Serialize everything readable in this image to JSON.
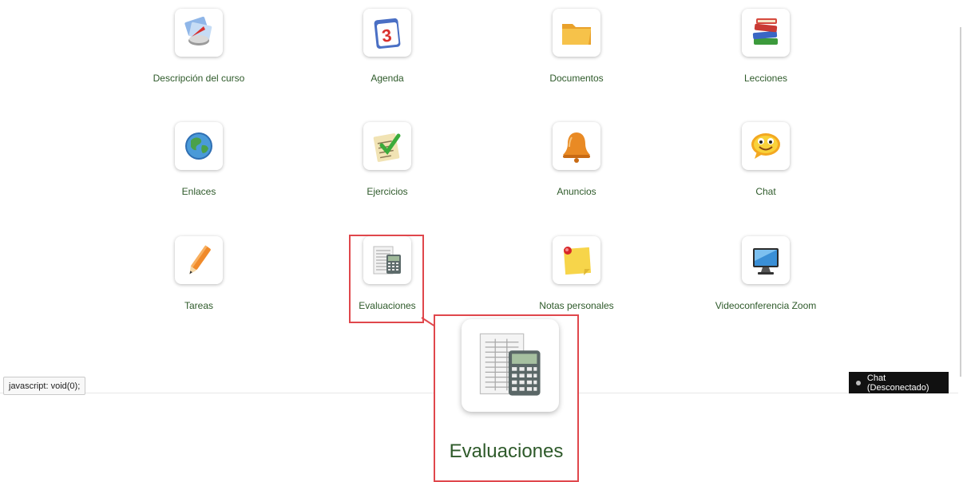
{
  "tools": [
    {
      "label": "Descripción del curso",
      "icon": "course-description-icon"
    },
    {
      "label": "Agenda",
      "icon": "calendar-icon"
    },
    {
      "label": "Documentos",
      "icon": "folder-icon"
    },
    {
      "label": "Lecciones",
      "icon": "books-icon"
    },
    {
      "label": "Enlaces",
      "icon": "globe-icon"
    },
    {
      "label": "Ejercicios",
      "icon": "exercise-checklist-icon"
    },
    {
      "label": "Anuncios",
      "icon": "bell-icon"
    },
    {
      "label": "Chat",
      "icon": "smiley-chat-icon"
    },
    {
      "label": "Tareas",
      "icon": "pencil-icon"
    },
    {
      "label": "Evaluaciones",
      "icon": "calculator-sheet-icon"
    },
    {
      "label": "Notas personales",
      "icon": "sticky-note-icon"
    },
    {
      "label": "Videoconferencia Zoom",
      "icon": "monitor-icon"
    }
  ],
  "agenda_day": "3",
  "zoom": {
    "label": "Evaluaciones",
    "icon": "calculator-sheet-icon"
  },
  "status_url": "javascript: void(0);",
  "chat_status": "Chat (Desconectado)",
  "colors": {
    "label_text": "#2e5a2a",
    "highlight": "#e0474c"
  }
}
